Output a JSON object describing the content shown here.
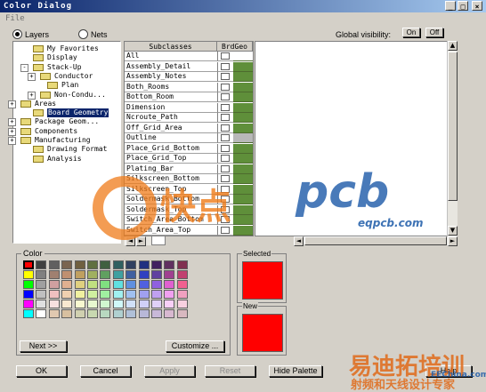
{
  "window": {
    "title": "Color Dialog"
  },
  "menu": {
    "file": "File"
  },
  "mode": {
    "layers_label": "Layers",
    "nets_label": "Nets",
    "selected": "Layers"
  },
  "global_visibility": {
    "label": "Global visibility:",
    "on_label": "On",
    "off_label": "Off"
  },
  "tree": [
    {
      "label": "My Favorites",
      "expander": ""
    },
    {
      "label": "Display",
      "expander": ""
    },
    {
      "label": "Stack-Up",
      "expander": "-"
    },
    {
      "label": "Conductor",
      "expander": "+"
    },
    {
      "label": "Plan",
      "expander": ""
    },
    {
      "label": "Non-Condu...",
      "expander": "+"
    },
    {
      "label": "Areas",
      "expander": "+"
    },
    {
      "label": "Board Geometry",
      "expander": "",
      "selected": true
    },
    {
      "label": "Package Geom...",
      "expander": "+"
    },
    {
      "label": "Components",
      "expander": "+"
    },
    {
      "label": "Manufacturing",
      "expander": "+"
    },
    {
      "label": "Drawing Format",
      "expander": ""
    },
    {
      "label": "Analysis",
      "expander": ""
    }
  ],
  "grid": {
    "col_subclasses": "Subclasses",
    "col_brdgeo": "BrdGeo",
    "rows": [
      {
        "name": "All",
        "color": "#ffffff"
      },
      {
        "name": "Assembly_Detail",
        "color": "#5f8f3a"
      },
      {
        "name": "Assembly_Notes",
        "color": "#5f8f3a"
      },
      {
        "name": "Both_Rooms",
        "color": "#5f8f3a"
      },
      {
        "name": "Bottom_Room",
        "color": "#5f8f3a"
      },
      {
        "name": "Dimension",
        "color": "#5f8f3a"
      },
      {
        "name": "Ncroute_Path",
        "color": "#5f8f3a"
      },
      {
        "name": "Off_Grid_Area",
        "color": "#5f8f3a"
      },
      {
        "name": "Outline",
        "color": "#b8b8b8"
      },
      {
        "name": "Place_Grid_Bottom",
        "color": "#5f8f3a"
      },
      {
        "name": "Place_Grid_Top",
        "color": "#5f8f3a"
      },
      {
        "name": "Plating_Bar",
        "color": "#5f8f3a"
      },
      {
        "name": "Silkscreen_Bottom",
        "color": "#5f8f3a"
      },
      {
        "name": "Silkscreen_Top",
        "color": "#5f8f3a"
      },
      {
        "name": "Soldermask_Bottom",
        "color": "#5f8f3a"
      },
      {
        "name": "Soldermask_Top",
        "color": "#5f8f3a"
      },
      {
        "name": "Switch_Area_Bottom",
        "color": "#5f8f3a"
      },
      {
        "name": "Switch_Area_Top",
        "color": "#5f8f3a"
      }
    ]
  },
  "color_group": {
    "label": "Color"
  },
  "palette": [
    [
      "#ff0000",
      "#404040",
      "#606060",
      "#7a6450",
      "#706040",
      "#607040",
      "#406040",
      "#306060",
      "#304060",
      "#203080",
      "#402060",
      "#603060",
      "#803050"
    ],
    [
      "#ffff00",
      "#808080",
      "#a08070",
      "#c09070",
      "#c0a060",
      "#a0b060",
      "#60a060",
      "#40a0a0",
      "#4060a0",
      "#3040c0",
      "#6040a0",
      "#a04090",
      "#c04070"
    ],
    [
      "#00ff00",
      "#a0a0a0",
      "#d0a0a0",
      "#e0b090",
      "#e0d080",
      "#c0e080",
      "#80e080",
      "#60e0e0",
      "#6090e0",
      "#5060e0",
      "#9060e0",
      "#e060d0",
      "#f06090"
    ],
    [
      "#0000ff",
      "#c0c0c0",
      "#f0c0c0",
      "#f0d0b0",
      "#f0f0a0",
      "#d0f0a0",
      "#a0f0a0",
      "#a0f0f0",
      "#a0c0f0",
      "#a0a0f0",
      "#c0a0f0",
      "#f0a0f0",
      "#f0a0c0"
    ],
    [
      "#ff00ff",
      "#e0e0e0",
      "#f8e0e0",
      "#f8e8d0",
      "#f8f8d0",
      "#e8f8d0",
      "#d0f8d0",
      "#d0f8f8",
      "#d0e0f8",
      "#d0d0f8",
      "#e0d0f8",
      "#f8d0f8",
      "#f8d0e0"
    ],
    [
      "#00ffff",
      "#ffffff",
      "#e0c8b0",
      "#d8c0a0",
      "#d0d0b0",
      "#c8d8b0",
      "#b8d8c0",
      "#b0d0d0",
      "#b0c0d8",
      "#b8b8d8",
      "#c8b8d8",
      "#d8b8d0",
      "#d8b8c0"
    ]
  ],
  "selected_color": "#ff0000",
  "new_color": "#ff0000",
  "selected_label": "Selected",
  "new_label": "New",
  "buttons": {
    "next": "Next >>",
    "customize": "Customize ...",
    "ok": "OK",
    "cancel": "Cancel",
    "apply": "Apply",
    "reset": "Reset",
    "hide_palette": "Hide Palette",
    "help": "Help"
  },
  "watermark": {
    "brand_cn": "快点",
    "brand": "pcb",
    "site": "eqpcb.com",
    "bottom_cn": "易迪拓培训",
    "bottom_cn2": "射频和天线设计专家",
    "eechina": "EEChina.com"
  }
}
